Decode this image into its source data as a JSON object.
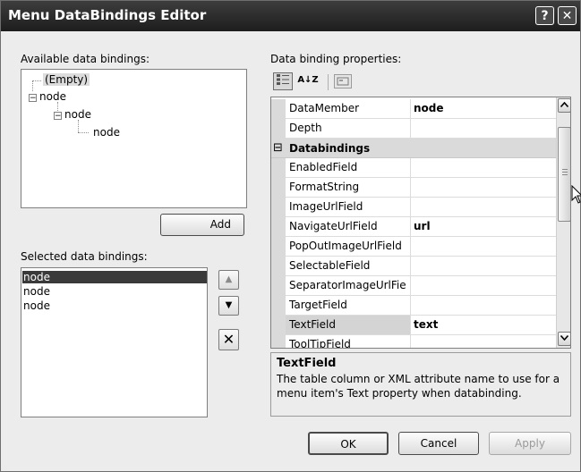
{
  "window": {
    "title": "Menu DataBindings Editor",
    "help_glyph": "?",
    "close_glyph": "✕"
  },
  "available": {
    "label": "Available data bindings:",
    "tree": [
      "(Empty)",
      "node",
      "node",
      "node"
    ],
    "add_label": "Add"
  },
  "selected": {
    "label": "Selected data bindings:",
    "items": [
      "node",
      "node",
      "node"
    ],
    "up_glyph": "▲",
    "down_glyph": "▼",
    "delete_glyph": "✕"
  },
  "properties": {
    "label": "Data binding properties:",
    "toolbar": {
      "categorized_icon": "categorized-icon",
      "alphabetical_glyph": "A↓Z",
      "property_pages_icon": "property-pages-icon"
    },
    "rows": [
      {
        "name": "DataMember",
        "value": "node"
      },
      {
        "name": "Depth",
        "value": ""
      },
      {
        "category": "Databindings",
        "toggle": "⊟"
      },
      {
        "name": "EnabledField",
        "value": ""
      },
      {
        "name": "FormatString",
        "value": ""
      },
      {
        "name": "ImageUrlField",
        "value": ""
      },
      {
        "name": "NavigateUrlField",
        "value": "url"
      },
      {
        "name": "PopOutImageUrlField",
        "value": ""
      },
      {
        "name": "SelectableField",
        "value": ""
      },
      {
        "name": "SeparatorImageUrlFie",
        "value": ""
      },
      {
        "name": "TargetField",
        "value": ""
      },
      {
        "name": "TextField",
        "value": "text"
      },
      {
        "name": "ToolTipField",
        "value": ""
      }
    ],
    "description_title": "TextField",
    "description_text": "The table column or XML attribute name to use for a menu item's Text property when databinding."
  },
  "buttons": {
    "ok": "OK",
    "cancel": "Cancel",
    "apply": "Apply"
  }
}
